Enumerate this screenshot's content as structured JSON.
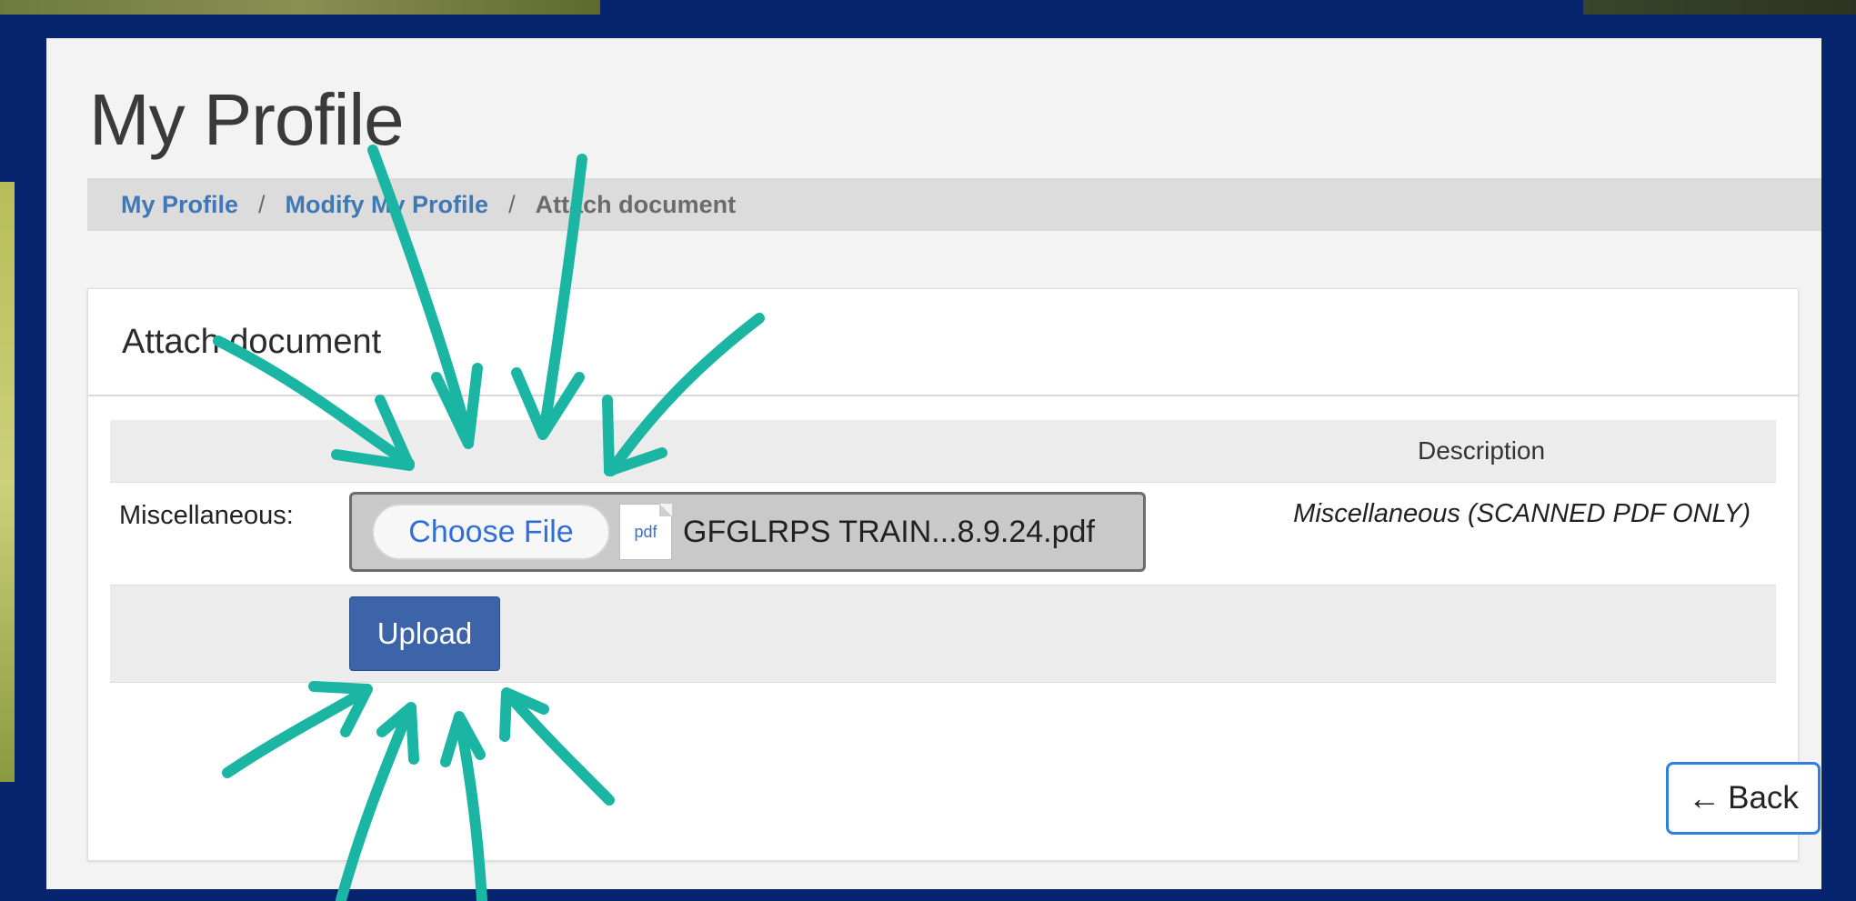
{
  "page": {
    "title": "My Profile"
  },
  "breadcrumb": {
    "items": [
      "My Profile",
      "Modify My Profile",
      "Attach document"
    ],
    "separator": "/"
  },
  "card": {
    "title": "Attach document",
    "table": {
      "header_description": "Description",
      "row": {
        "label": "Miscellaneous:",
        "choose_file_label": "Choose File",
        "file_icon_text": "pdf",
        "file_name": "GFGLRPS TRAIN...8.9.24.pdf",
        "description": "Miscellaneous (SCANNED PDF ONLY)"
      },
      "upload_label": "Upload"
    },
    "back_label": "Back"
  },
  "colors": {
    "frame": "#06256e",
    "link": "#3f78b5",
    "upload_button": "#3d63a8",
    "back_border": "#2f7fe3",
    "annotation_arrows": "#1ab5a3"
  },
  "icons": {
    "file_type": "pdf-file-icon",
    "back": "arrow-left-icon"
  }
}
